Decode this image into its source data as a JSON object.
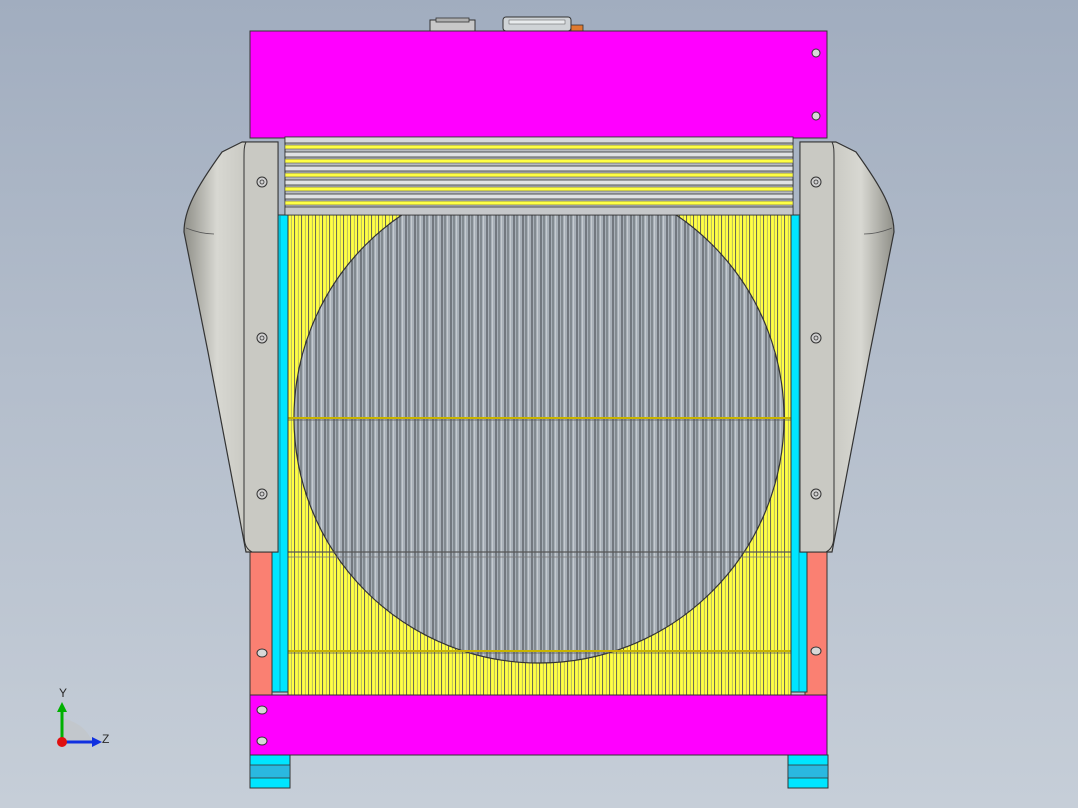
{
  "viewport": {
    "background_top": "#a1adbf",
    "background_bottom": "#c6ced8"
  },
  "model": {
    "name_icon": "radiator-assembly-front-view",
    "colors": {
      "frame_top_bottom": "#ff00ff",
      "side_plates": "#fa8072",
      "core_fins": "#ffff44",
      "side_channels": "#00e5ff",
      "shroud": "#c6c6c0",
      "fan": "#a8b0b8",
      "feet": "#00e5ff",
      "filler_cap": "#e07a30"
    }
  },
  "triad": {
    "icon": "coordinate-triad-icon",
    "y_label": "Y",
    "z_label": "Z",
    "y_color": "#00b000",
    "z_color": "#1030e0",
    "x_color": "#e01010"
  }
}
